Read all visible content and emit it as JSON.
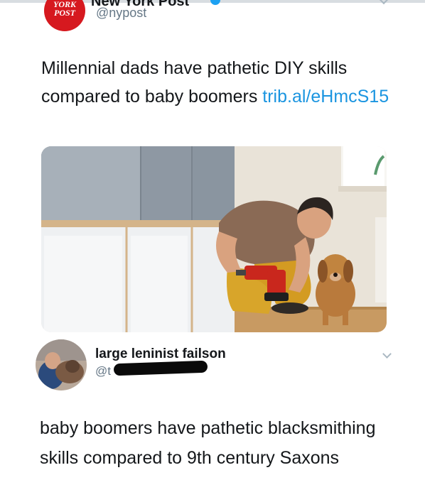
{
  "original_tweet": {
    "logo_text_line1": "YORK",
    "logo_text_line2": "POST",
    "display_name": "New York Post",
    "handle": "@nypost",
    "text": "Millennial dads have pathetic DIY skills compared to baby boomers ",
    "link_text": "trib.al/eHmcS15",
    "image_description_icon": "man-drilling-with-dog-photo",
    "logo_color": "#d6191f",
    "link_color": "#1b95e0"
  },
  "reply": {
    "display_name": "large leninist failson",
    "handle_visible": "@t",
    "text": "baby boomers have pathetic blacksmithing skills compared to 9th century Saxons",
    "avatar_icon": "person-with-dog-avatar"
  },
  "icons": {
    "verified": "verified-badge-icon",
    "menu": "chevron-down-icon"
  }
}
